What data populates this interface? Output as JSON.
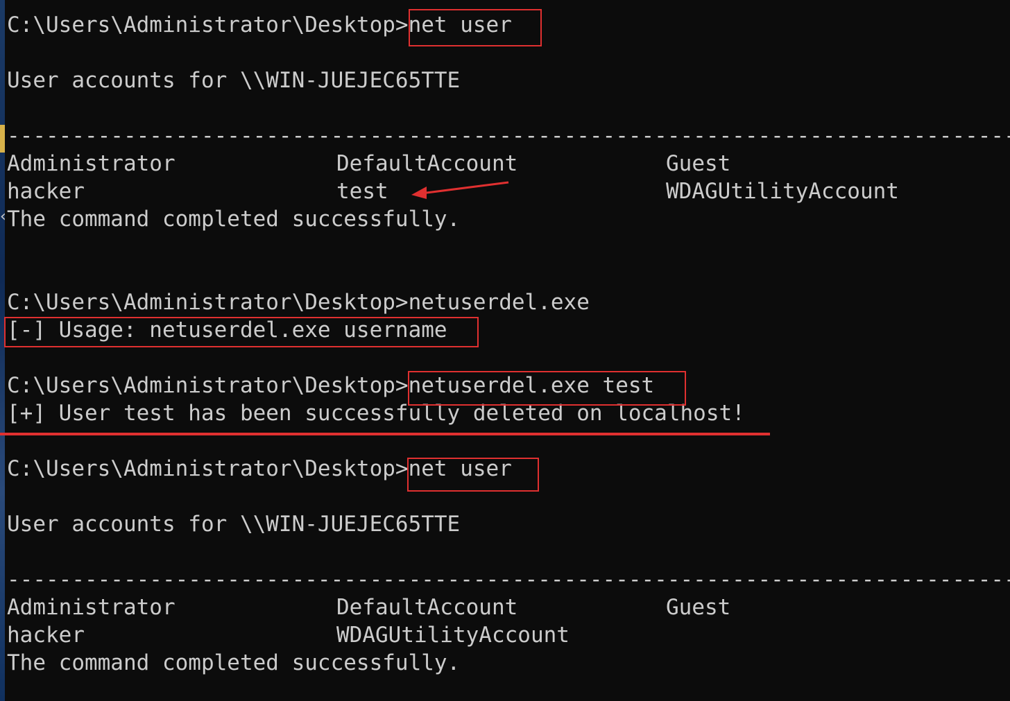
{
  "session1": {
    "prompt": "C:\\Users\\Administrator\\Desktop>",
    "command": "net user",
    "header": "User accounts for \\\\WIN-JUEJEC65TTE",
    "separator": "-------------------------------------------------------------------------------",
    "rows": [
      [
        "Administrator",
        "DefaultAccount",
        "Guest"
      ],
      [
        "hacker",
        "test",
        "WDAGUtilityAccount"
      ]
    ],
    "result": "The command completed successfully."
  },
  "session2": {
    "prompt": "C:\\Users\\Administrator\\Desktop>",
    "command": "netuserdel.exe",
    "output": "[-] Usage: netuserdel.exe username"
  },
  "session3": {
    "prompt": "C:\\Users\\Administrator\\Desktop>",
    "command": "netuserdel.exe test",
    "output": "[+] User test has been successfully deleted on localhost!"
  },
  "session4": {
    "prompt": "C:\\Users\\Administrator\\Desktop>",
    "command": "net user",
    "header": "User accounts for \\\\WIN-JUEJEC65TTE",
    "separator": "-------------------------------------------------------------------------------",
    "rows": [
      [
        "Administrator",
        "DefaultAccount",
        "Guest"
      ],
      [
        "hacker",
        "WDAGUtilityAccount",
        ""
      ]
    ],
    "result": "The command completed successfully."
  },
  "colors": {
    "background": "#0c0c0c",
    "text": "#cccccc",
    "annotation": "#e03030"
  }
}
